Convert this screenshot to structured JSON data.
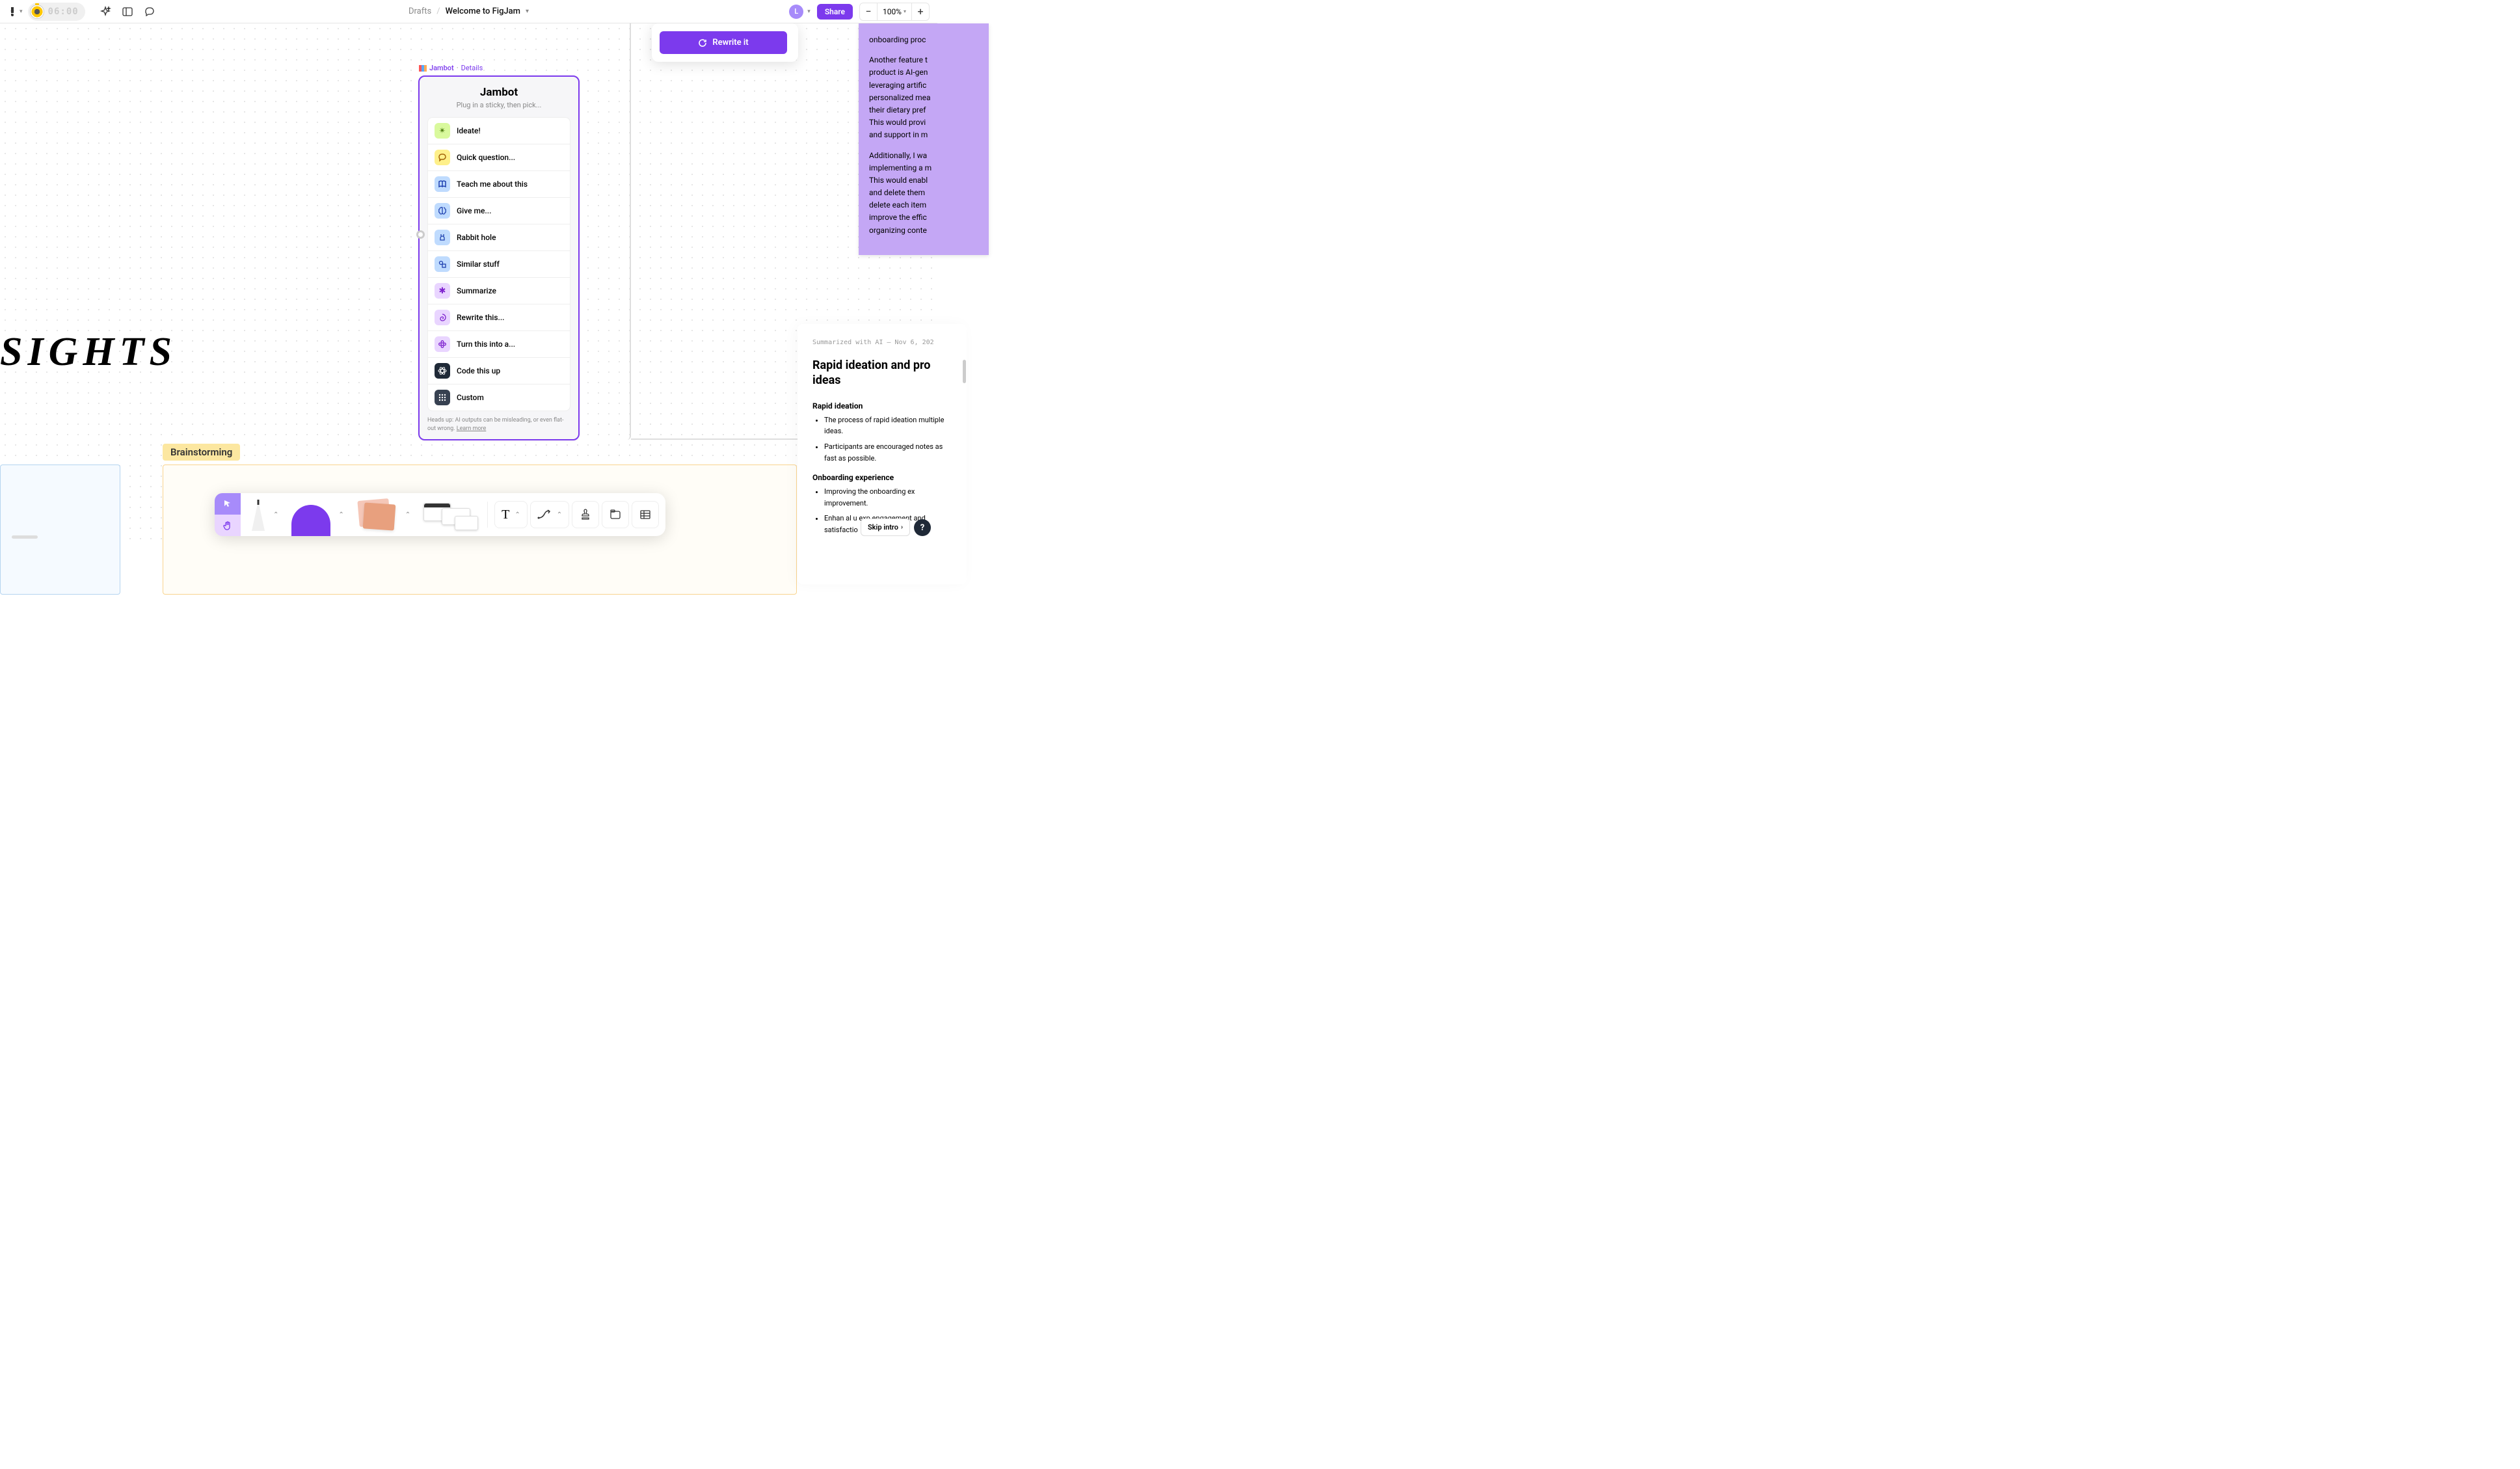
{
  "topbar": {
    "timer": "06:00",
    "breadcrumb_parent": "Drafts",
    "breadcrumb_current": "Welcome to FigJam",
    "avatar_initial": "L",
    "share_label": "Share",
    "zoom": "100%"
  },
  "jambot_label": {
    "name": "Jambot",
    "details": "Details"
  },
  "jambot": {
    "title": "Jambot",
    "subtitle": "Plug in a sticky, then pick...",
    "items": [
      {
        "label": "Ideate!",
        "icon": "sparkle",
        "color": "green"
      },
      {
        "label": "Quick question...",
        "icon": "chat",
        "color": "yellow"
      },
      {
        "label": "Teach me about this",
        "icon": "book",
        "color": "blue"
      },
      {
        "label": "Give me...",
        "icon": "brain",
        "color": "blue"
      },
      {
        "label": "Rabbit hole",
        "icon": "rabbit",
        "color": "blue"
      },
      {
        "label": "Similar stuff",
        "icon": "shapes",
        "color": "blue"
      },
      {
        "label": "Summarize",
        "icon": "asterisk",
        "color": "purple"
      },
      {
        "label": "Rewrite this...",
        "icon": "swirl",
        "color": "purple"
      },
      {
        "label": "Turn this into a...",
        "icon": "flower",
        "color": "purple"
      },
      {
        "label": "Code this up",
        "icon": "atom",
        "color": "dark"
      },
      {
        "label": "Custom",
        "icon": "grid",
        "color": "gray"
      }
    ],
    "footer_text": "Heads up: AI outputs can be misleading, or even flat-out wrong. ",
    "footer_link": "Learn more"
  },
  "rewrite": {
    "button": "Rewrite it"
  },
  "canvas": {
    "sights_text": "SIGHTS",
    "brainstorm_label": "Brainstorming",
    "rapid_heading": "Rapid ideation"
  },
  "purple_sticky": {
    "p1_fragment": "onboarding proc",
    "p2": "Another feature t\nproduct is AI-gen\nleveraging artific\npersonalized mea\ntheir dietary pref\nThis would provi\nand support in m",
    "p3": "Additionally, I wa\nimplementing a m\nThis would enabl\nand delete them \ndelete each item \nimprove the effic\norganizing conte"
  },
  "summary": {
    "meta": "Summarized with AI — Nov 6, 202",
    "title": "Rapid ideation and pro ideas",
    "h1": "Rapid ideation",
    "b1": "The process of rapid ideation multiple ideas.",
    "b2": "Participants are encouraged notes as fast as possible.",
    "h2": "Onboarding experience",
    "b3": "Improving the onboarding ex improvement.",
    "b4": "Enhan                al u   exp engagement and satisfactio"
  },
  "footer": {
    "skip": "Skip intro",
    "help": "?"
  }
}
